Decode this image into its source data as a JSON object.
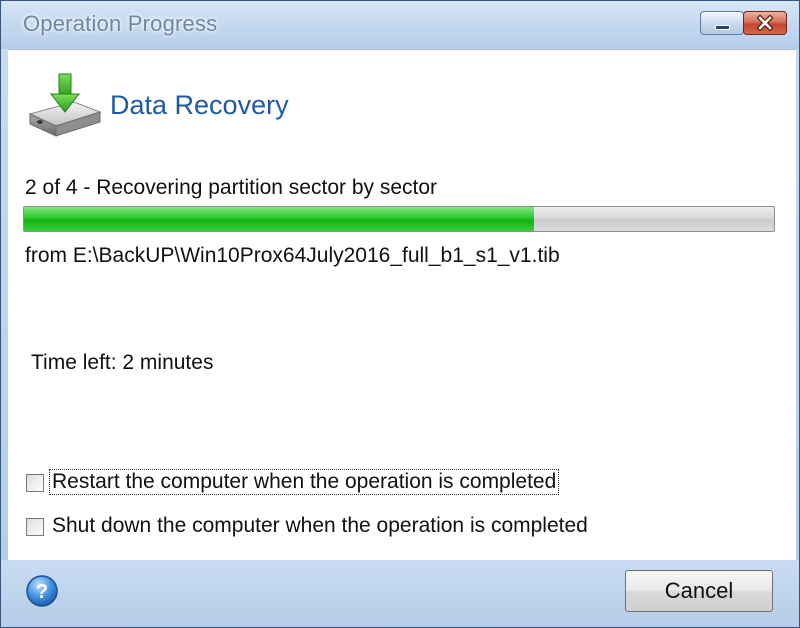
{
  "window": {
    "title": "Operation Progress"
  },
  "header": {
    "icon": "hard-drive-download-icon",
    "title": "Data Recovery"
  },
  "progress": {
    "step_text": "2 of 4 - Recovering partition sector by sector",
    "fraction": 0.68,
    "source_text": "from E:\\BackUP\\Win10Prox64July2016_full_b1_s1_v1.tib",
    "time_left": "Time left: 2 minutes"
  },
  "options": {
    "restart_label": "Restart the computer when the operation is completed",
    "restart_checked": false,
    "shutdown_label": "Shut down the computer when the operation is completed",
    "shutdown_checked": false
  },
  "footer": {
    "help_icon": "help-icon",
    "cancel_label": "Cancel"
  },
  "colors": {
    "progress_fill": "#22c322",
    "header_title": "#1d59a8",
    "titlebar": "#c3d7ef"
  }
}
